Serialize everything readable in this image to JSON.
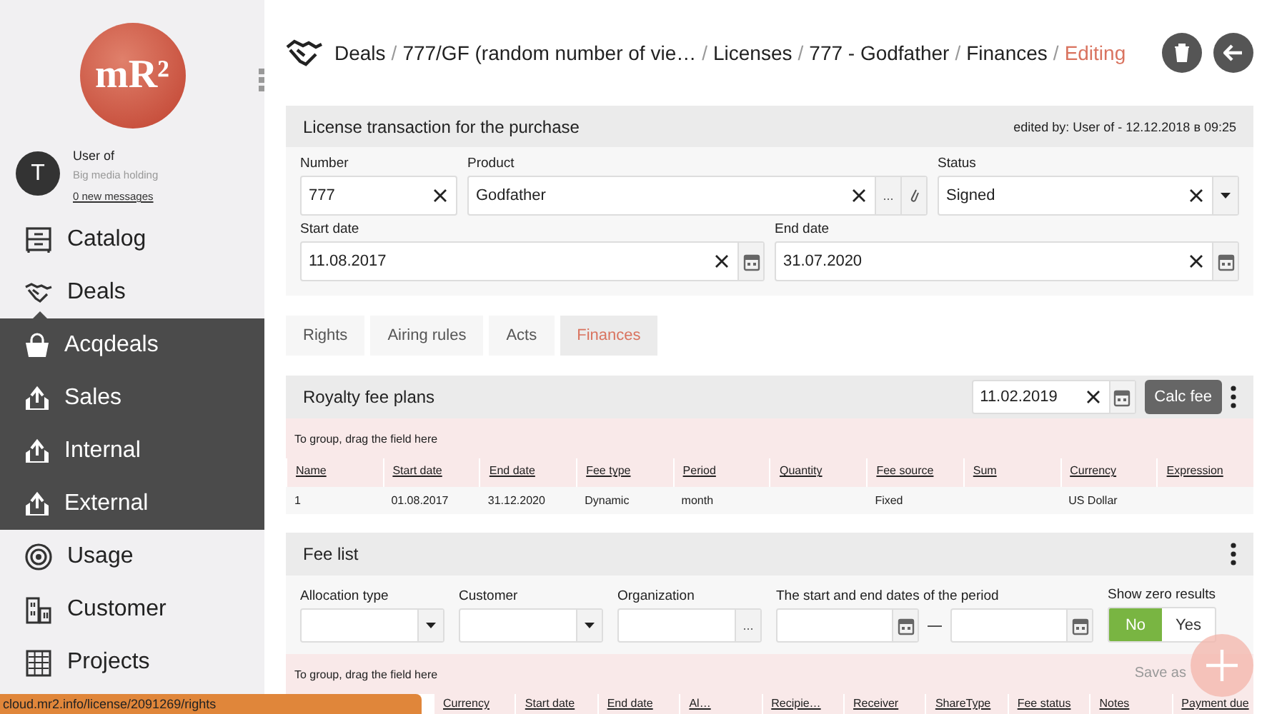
{
  "sidebar": {
    "logo": "mR²",
    "user": {
      "initial": "T",
      "name": "User of",
      "org": "Big media holding",
      "messages": "0 new messages"
    },
    "nav": [
      {
        "label": "Catalog"
      },
      {
        "label": "Deals",
        "expanded": true,
        "children": [
          {
            "label": "Acqdeals"
          },
          {
            "label": "Sales"
          },
          {
            "label": "Internal"
          },
          {
            "label": "External"
          }
        ]
      },
      {
        "label": "Usage"
      },
      {
        "label": "Customer"
      },
      {
        "label": "Projects"
      }
    ]
  },
  "breadcrumb_separator": "/",
  "breadcrumb": [
    {
      "label": "Deals",
      "current": false
    },
    {
      "label": "777/GF (random number of vie…",
      "current": false
    },
    {
      "label": "Licenses",
      "current": false
    },
    {
      "label": "777 - Godfather",
      "current": false
    },
    {
      "label": "Finances",
      "current": false
    },
    {
      "label": "Editing",
      "current": true
    }
  ],
  "license": {
    "title": "License transaction for the purchase",
    "edited": "edited by: User of - 12.12.2018 в 09:25",
    "rows": [
      [
        {
          "label": "Number",
          "value": "777",
          "kind": "text"
        },
        {
          "label": "Product",
          "value": "Godfather",
          "kind": "lookup",
          "browse": "..."
        },
        {
          "label": "Status",
          "value": "Signed",
          "kind": "select"
        }
      ],
      [
        {
          "label": "Start date",
          "value": "11.08.2017",
          "kind": "date"
        },
        {
          "label": "End date",
          "value": "31.07.2020",
          "kind": "date"
        }
      ]
    ]
  },
  "tabs": [
    {
      "label": "Rights",
      "selected": false
    },
    {
      "label": "Airing rules",
      "selected": false
    },
    {
      "label": "Acts",
      "selected": false
    },
    {
      "label": "Finances",
      "selected": true
    }
  ],
  "royalty": {
    "title": "Royalty fee plans",
    "date": "11.02.2019",
    "button": "Calc fee",
    "group_hint": "To group, drag the field here",
    "columns": [
      "Name",
      "Start date",
      "End date",
      "Fee type",
      "Period",
      "Quantity",
      "Fee source",
      "Sum",
      "Currency",
      "Expression"
    ],
    "rows": [
      [
        "1",
        "01.08.2017",
        "31.12.2020",
        "Dynamic",
        "month",
        "",
        "Fixed",
        "",
        "US Dollar",
        ""
      ]
    ]
  },
  "fee_list": {
    "title": "Fee list",
    "filters": [
      {
        "label": "Allocation type",
        "kind": "select"
      },
      {
        "label": "Customer",
        "kind": "select"
      },
      {
        "label": "Organization",
        "kind": "lookup",
        "browse": "..."
      },
      {
        "label": "The start and end dates of the period",
        "kind": "date_range"
      }
    ],
    "zero": {
      "label": "Show zero results",
      "options": [
        {
          "label": "No",
          "selected": true
        },
        {
          "label": "Yes",
          "selected": false
        }
      ]
    },
    "group_hint": "To group, drag the field here",
    "save_as": "Save as",
    "columns": [
      "Currency",
      "Start date",
      "End date",
      "Al…",
      "Recipie…",
      "Receiver",
      "ShareType",
      "Fee status",
      "Notes",
      "Payment due"
    ]
  },
  "status_url": "cloud.mr2.info/license/2091269/rights"
}
